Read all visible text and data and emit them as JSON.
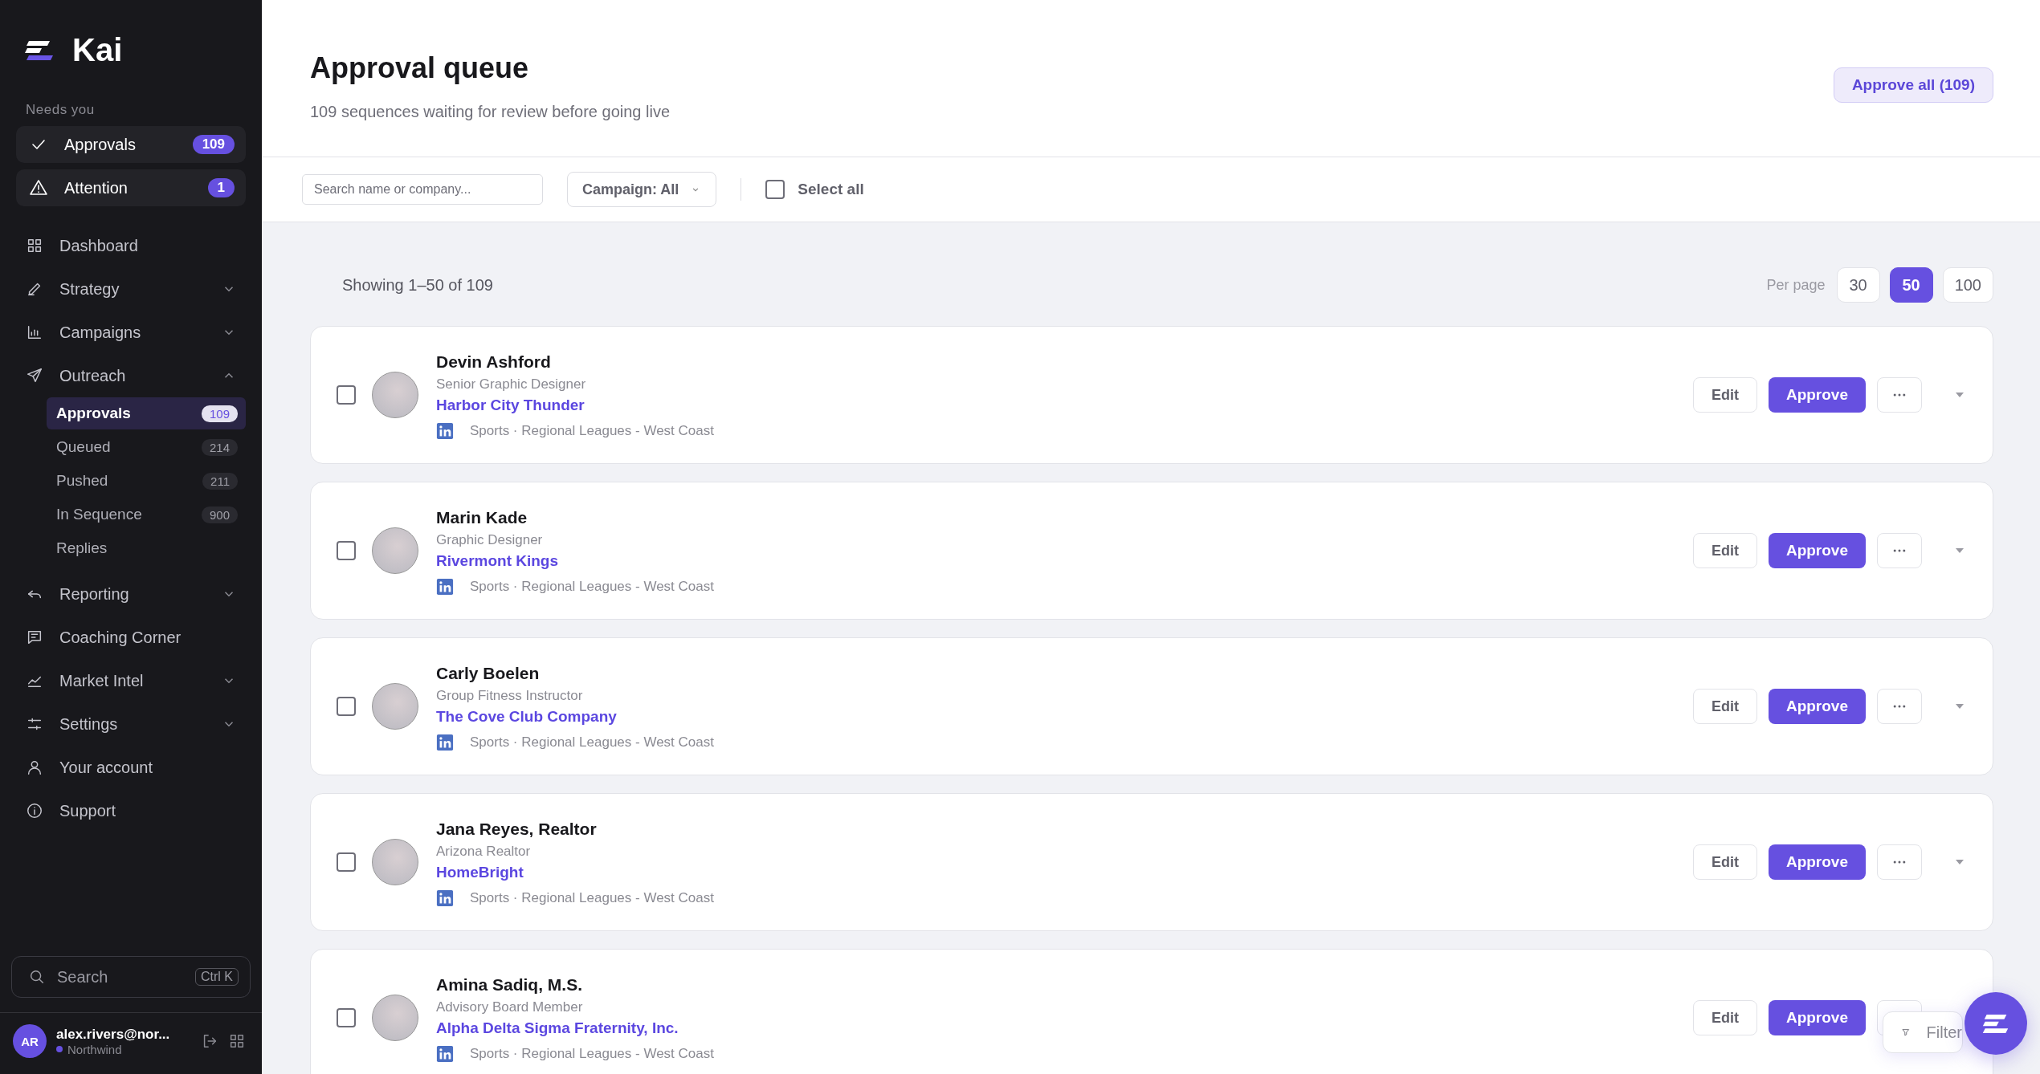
{
  "sidebar": {
    "brand": "Kai",
    "section_label": "Needs you",
    "priority_items": [
      {
        "label": "Approvals",
        "count": "109",
        "selected": false
      },
      {
        "label": "Attention",
        "count": "1",
        "selected": false
      }
    ],
    "nav_items": [
      {
        "label": "Dashboard",
        "kind": "link"
      },
      {
        "label": "Strategy",
        "kind": "group",
        "expanded": false
      },
      {
        "label": "Campaigns",
        "kind": "group",
        "expanded": false
      },
      {
        "label": "Outreach",
        "kind": "group",
        "expanded": true,
        "children": [
          {
            "label": "Approvals",
            "count": "109",
            "selected": true
          },
          {
            "label": "Queued",
            "count": "214",
            "selected": false
          },
          {
            "label": "Pushed",
            "count": "211",
            "selected": false
          },
          {
            "label": "In Sequence",
            "count": "900",
            "selected": false
          },
          {
            "label": "Replies",
            "selected": false
          }
        ]
      },
      {
        "label": "Reporting",
        "kind": "group",
        "expanded": false
      },
      {
        "label": "Coaching Corner",
        "kind": "link"
      },
      {
        "label": "Market Intel",
        "kind": "group",
        "expanded": false
      },
      {
        "label": "Settings",
        "kind": "group",
        "expanded": false
      },
      {
        "label": "Your account",
        "kind": "link"
      },
      {
        "label": "Support",
        "kind": "link"
      }
    ],
    "search": {
      "placeholder": "Search",
      "shortcut": "Ctrl K"
    },
    "user": {
      "initials": "AR",
      "email": "alex.rivers@nor...",
      "workspace": "Northwind",
      "color": "#6650e0"
    }
  },
  "header": {
    "title": "Approval queue",
    "subtitle": "109 sequences waiting for review before going live",
    "approve_all": "Approve all (109)"
  },
  "toolbar": {
    "search": {
      "placeholder": "Search name or company..."
    },
    "campaign_filter": "Campaign: All",
    "select_all": {
      "label": "Select all",
      "checked": false
    }
  },
  "summary": "Showing 1–50 of 109",
  "per_page": {
    "label": "Per page",
    "options": [
      {
        "label": "30",
        "selected": false
      },
      {
        "label": "50",
        "selected": true
      },
      {
        "label": "100",
        "selected": false
      }
    ]
  },
  "cards": [
    {
      "name": "Devin Ashford",
      "title": "Senior Graphic Designer",
      "company": "Harbor City Thunder",
      "tags": "Sports · Regional Leagues - West Coast",
      "checked": false,
      "edit": "Edit",
      "approve": "Approve"
    },
    {
      "name": "Marin Kade",
      "title": "Graphic Designer",
      "company": "Rivermont Kings",
      "tags": "Sports · Regional Leagues - West Coast",
      "checked": false,
      "edit": "Edit",
      "approve": "Approve"
    },
    {
      "name": "Carly Boelen",
      "title": "Group Fitness Instructor",
      "company": "The Cove Club Company",
      "tags": "Sports · Regional Leagues - West Coast",
      "checked": false,
      "edit": "Edit",
      "approve": "Approve"
    },
    {
      "name": "Jana Reyes, Realtor",
      "title": "Arizona Realtor",
      "company": "HomeBright",
      "tags": "Sports · Regional Leagues - West Coast",
      "checked": false,
      "edit": "Edit",
      "approve": "Approve"
    },
    {
      "name": "Amina Sadiq, M.S.",
      "title": "Advisory Board Member",
      "company": "Alpha Delta Sigma Fraternity, Inc.",
      "tags": "Sports · Regional Leagues - West Coast",
      "checked": false,
      "edit": "Edit",
      "approve": "Approve"
    }
  ],
  "filter_button": "Filter"
}
